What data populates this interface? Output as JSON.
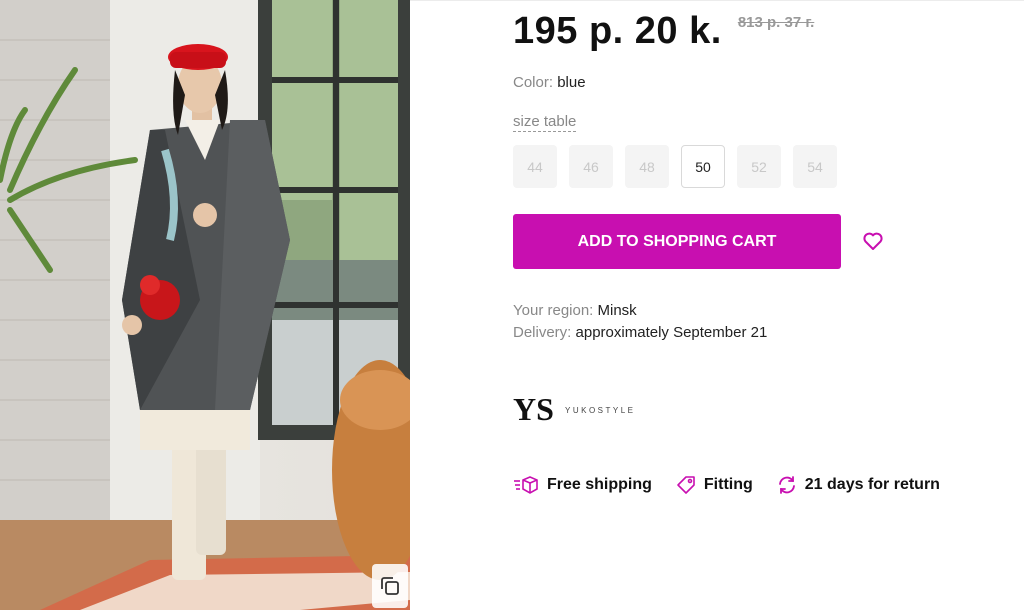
{
  "price": {
    "current": "195 р. 20 k.",
    "old": "813 р. 37 г."
  },
  "color": {
    "label": "Color:",
    "value": "blue"
  },
  "size_table_link": "size table",
  "sizes": [
    {
      "label": "44",
      "available": false
    },
    {
      "label": "46",
      "available": false
    },
    {
      "label": "48",
      "available": false
    },
    {
      "label": "50",
      "available": true,
      "selected": true
    },
    {
      "label": "52",
      "available": false
    },
    {
      "label": "54",
      "available": false
    }
  ],
  "cart_button": "ADD TO SHOPPING CART",
  "region": {
    "label": "Your region:",
    "value": "Minsk"
  },
  "delivery": {
    "label": "Delivery:",
    "value": "approximately September 21"
  },
  "brand": {
    "name": "YUKOSTYLE",
    "logo_text": "YS"
  },
  "features": [
    {
      "icon": "truck-icon",
      "label": "Free shipping"
    },
    {
      "icon": "tag-icon",
      "label": "Fitting"
    },
    {
      "icon": "refresh-icon",
      "label": "21 days for return"
    }
  ],
  "colors": {
    "accent": "#c80fb0",
    "text": "#111111",
    "muted": "#888888"
  }
}
